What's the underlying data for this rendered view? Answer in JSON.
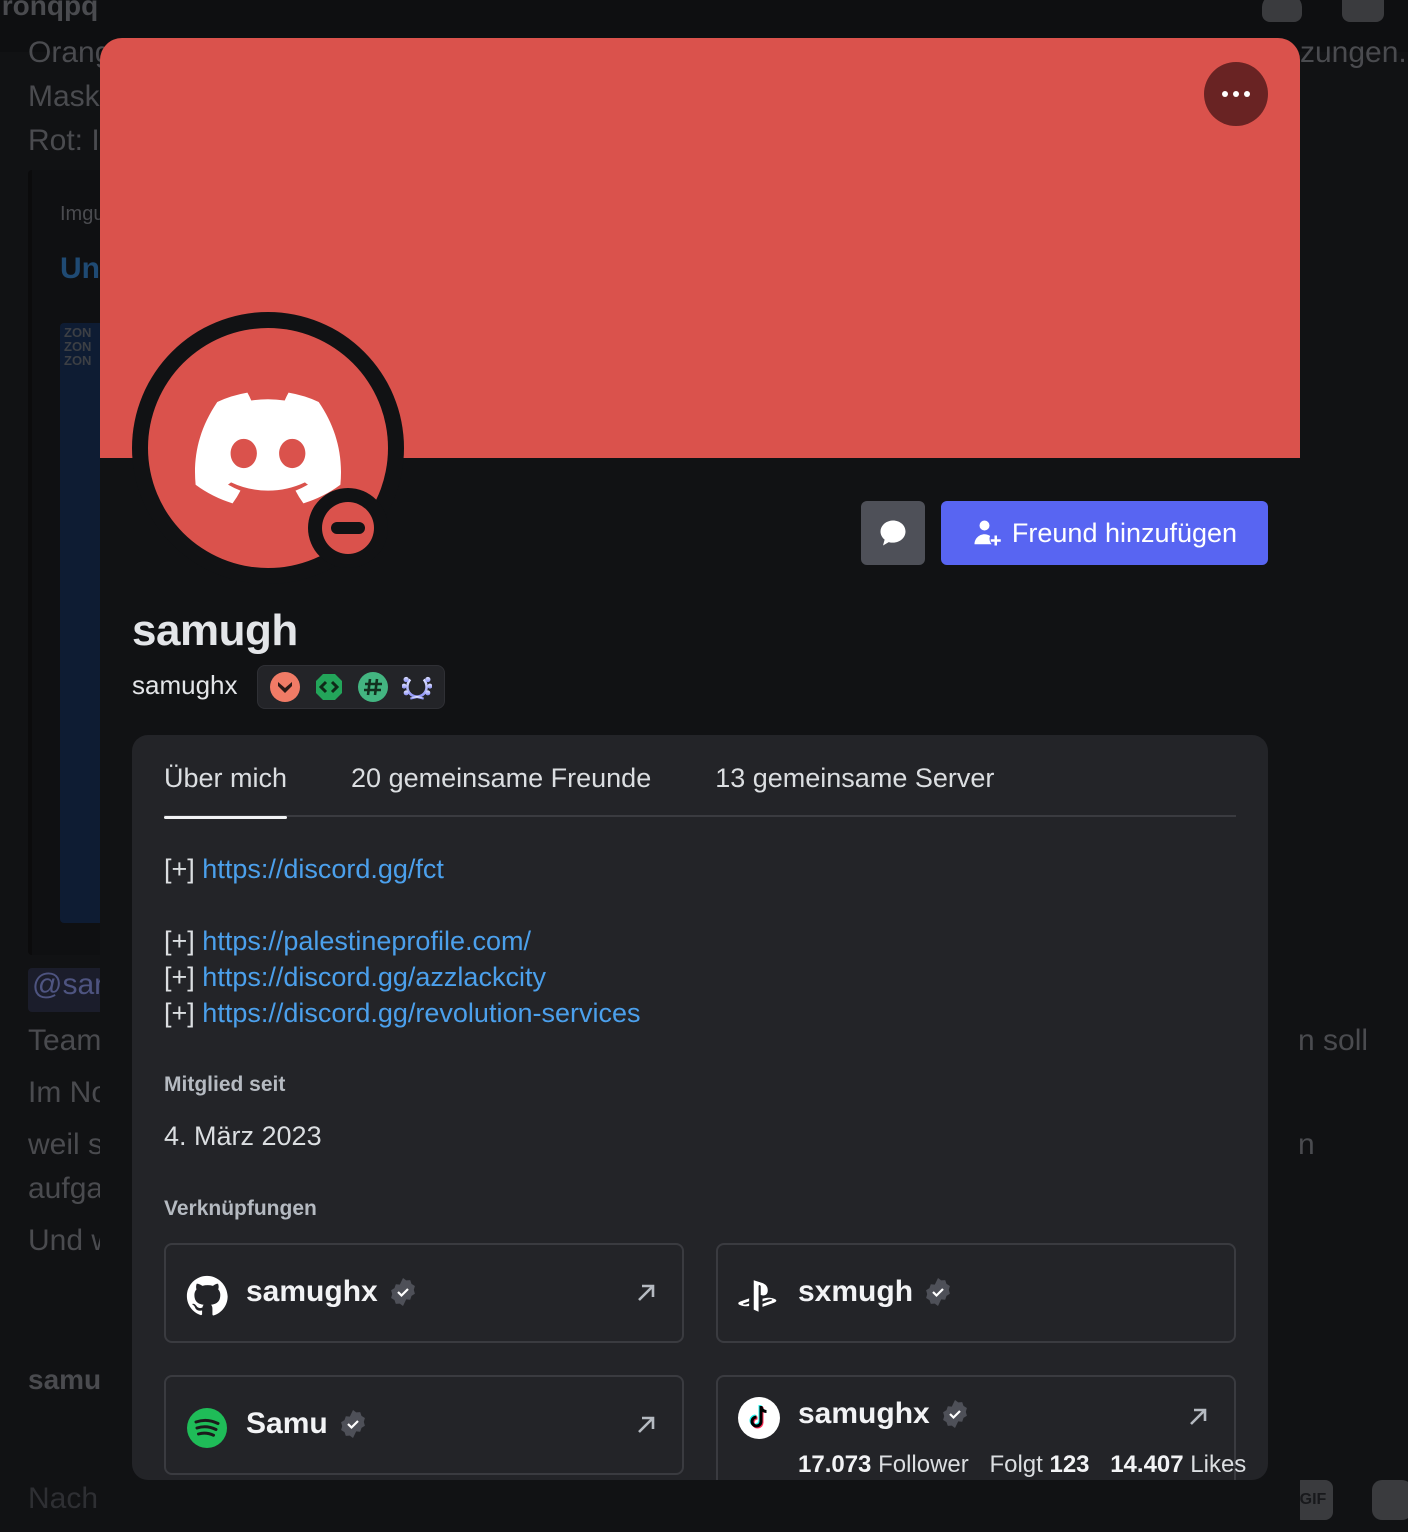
{
  "background": {
    "channel_title_fragment": "ironqpq",
    "text_fragments": [
      "Orang",
      "Mask",
      "Rot: I",
      "Team",
      "Im No",
      "weil s",
      "aufga",
      "Und w",
      "zungen.",
      "n soll",
      "n"
    ],
    "embed_source_fragment": "Imgu",
    "embed_title_fragment": "Un",
    "embed_image_text": "ZON\nZON\nZON",
    "mention_fragment": "@sar",
    "author_fragment": "samu",
    "input_placeholder_fragment": "Nach",
    "gif_label": "GIF"
  },
  "profile": {
    "display_name": "samugh",
    "username": "samughx",
    "banner_color": "#da524c",
    "avatar_color": "#da524c",
    "status": "do-not-disturb",
    "badges": [
      {
        "name": "hypesquad-brilliance-badge",
        "color": "#f07b66"
      },
      {
        "name": "active-developer-badge",
        "color": "#23a55a"
      },
      {
        "name": "moderator-programs-alumni-badge",
        "color": "#43b581"
      },
      {
        "name": "nitro-laurel-badge",
        "color": "#a3aaff"
      }
    ],
    "actions": {
      "more_label": "More",
      "message_label": "Message",
      "add_friend_label": "Freund hinzufügen"
    }
  },
  "tabs": [
    {
      "label": "Über mich",
      "active": true
    },
    {
      "label": "20 gemeinsame Freunde",
      "active": false
    },
    {
      "label": "13 gemeinsame Server",
      "active": false
    }
  ],
  "bio": {
    "prefix": "[+]",
    "links": [
      "https://discord.gg/fct",
      "https://palestineprofile.com/",
      "https://discord.gg/azzlackcity",
      "https://discord.gg/revolution-services"
    ]
  },
  "member_since": {
    "title": "Mitglied seit",
    "date": "4. März 2023"
  },
  "connections": {
    "title": "Verknüpfungen",
    "items": [
      {
        "service": "github",
        "name": "samughx",
        "verified": true,
        "has_link": true
      },
      {
        "service": "playstation",
        "name": "sxmugh",
        "verified": true,
        "has_link": false
      },
      {
        "service": "spotify",
        "name": "Samu",
        "verified": true,
        "has_link": true
      },
      {
        "service": "tiktok",
        "name": "samughx",
        "verified": true,
        "has_link": true,
        "stats": {
          "followers_value": "17.073",
          "followers_label": "Follower",
          "following_label": "Folgt",
          "following_value": "123",
          "likes_value": "14.407",
          "likes_label": "Likes"
        }
      }
    ]
  },
  "colors": {
    "accent": "#5865f2",
    "link": "#4ba0ec",
    "panel_bg": "#232428",
    "popout_bg": "#111214",
    "dnd_red": "#da524c"
  }
}
